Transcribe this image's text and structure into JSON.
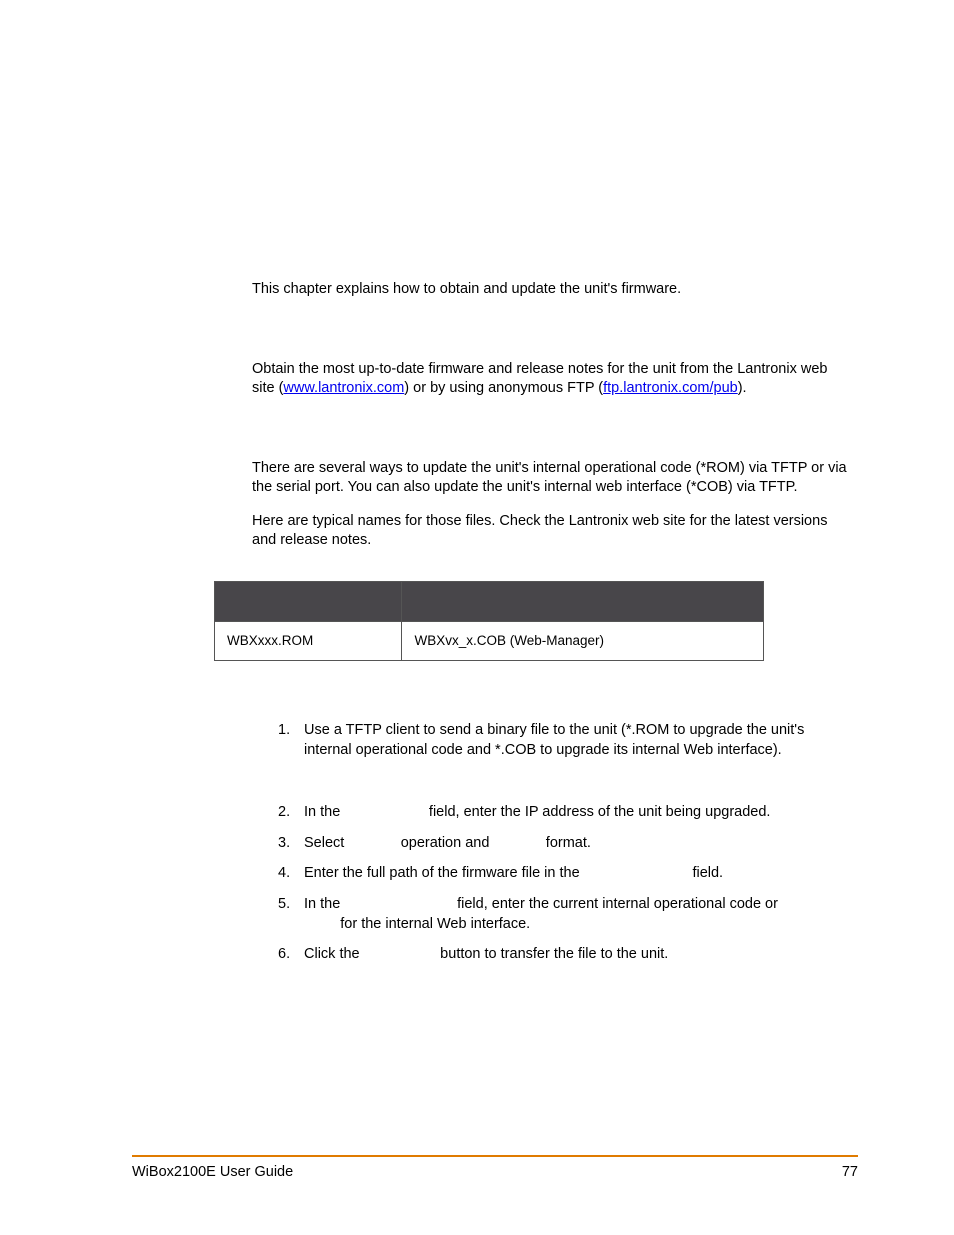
{
  "intro": "This chapter explains how to obtain and update the unit's firmware.",
  "obtain": {
    "pre": "Obtain the most up-to-date firmware and release notes for the unit from the Lantronix web site (",
    "link1": "www.lantronix.com",
    "mid": ") or by using anonymous FTP (",
    "link2": "ftp.lantronix.com/pub",
    "post": ")."
  },
  "reload1": "There are several ways to update the unit's internal operational code (*ROM) via TFTP or via the serial port. You can also update the unit's internal web interface (*COB) via TFTP.",
  "reload2": "Here are typical names for those files. Check the Lantronix web site for the latest versions and release notes.",
  "table": {
    "h1": "",
    "h2": "",
    "c1": "WBXxxx.ROM",
    "c2": "WBXvx_x.COB (Web-Manager)"
  },
  "steps": {
    "s1": "Use a TFTP client to send a binary file to the unit (*.ROM to upgrade the unit's internal operational code and *.COB to upgrade its internal Web interface).",
    "s2a": "In the ",
    "s2b": " field, enter the IP address of the unit being upgraded.",
    "s3a": "Select ",
    "s3b": " operation and ",
    "s3c": " format.",
    "s4a": "Enter the full path of the firmware file in the ",
    "s4b": " field.",
    "s5a": "In the ",
    "s5b": " field, enter the current internal operational code or ",
    "s5c": " for the internal Web interface.",
    "s6a": "Click the ",
    "s6b": " button to transfer the file to the unit."
  },
  "footer": {
    "title": "WiBox2100E User Guide",
    "page": "77"
  }
}
